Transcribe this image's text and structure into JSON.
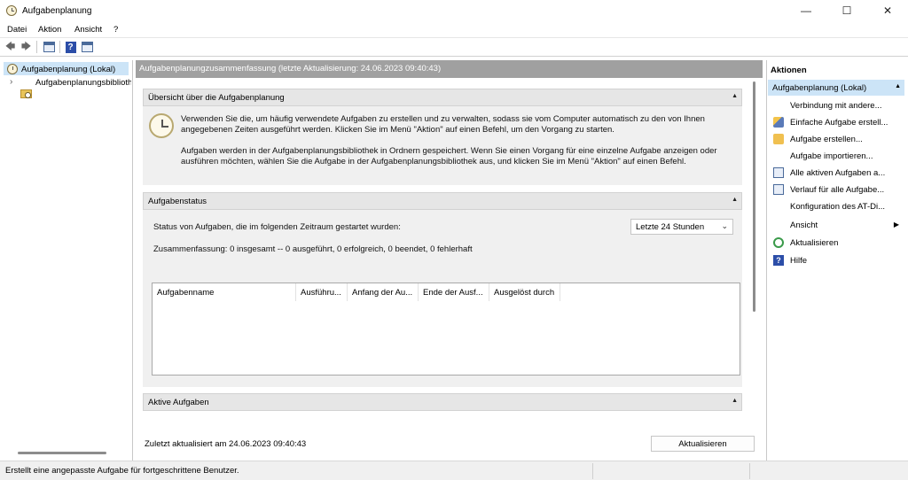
{
  "window": {
    "title": "Aufgabenplanung",
    "icon": "clock-icon",
    "controls": {
      "minimize": "—",
      "maximize": "☐",
      "close": "✕"
    }
  },
  "menu": {
    "items": [
      "Datei",
      "Aktion",
      "Ansicht",
      "?"
    ]
  },
  "toolbar": {
    "back": "🡄",
    "forward": "🡆",
    "help": "?"
  },
  "tree": {
    "root": "Aufgabenplanung (Lokal)",
    "child": "Aufgabenplanungsbibliothek",
    "expander": "›"
  },
  "center": {
    "header": "Aufgabenplanungzusammenfassung (letzte Aktualisierung: 24.06.2023 09:40:43)",
    "overview": {
      "title": "Übersicht über die Aufgabenplanung",
      "collapse": "▲",
      "para1": "Verwenden Sie die, um häufig verwendete Aufgaben zu erstellen und zu verwalten, sodass sie vom Computer automatisch zu den von Ihnen angegebenen Zeiten ausgeführt werden. Klicken Sie im Menü \"Aktion\" auf einen Befehl, um den Vorgang zu starten.",
      "para2": "Aufgaben werden in der Aufgabenplanungsbibliothek in Ordnern gespeichert. Wenn Sie einen Vorgang für eine einzelne Aufgabe anzeigen oder ausführen möchten, wählen Sie die Aufgabe in der Aufgabenplanungsbibliothek aus, und klicken Sie im Menü \"Aktion\" auf einen Befehl."
    },
    "status": {
      "title": "Aufgabenstatus",
      "collapse": "▲",
      "label": "Status von Aufgaben, die im folgenden Zeitraum gestartet wurden:",
      "period": "Letzte 24 Stunden",
      "period_chevron": "⌄",
      "summary": "Zusammenfassung: 0 insgesamt -- 0 ausgeführt, 0 erfolgreich, 0 beendet, 0 fehlerhaft",
      "columns": [
        "Aufgabenname",
        "Ausführu...",
        "Anfang der Au...",
        "Ende der Ausf...",
        "Ausgelöst durch"
      ]
    },
    "active": {
      "title": "Aktive Aufgaben",
      "collapse": "▲"
    },
    "last_updated": "Zuletzt aktualisiert am 24.06.2023 09:40:43",
    "refresh_button": "Aktualisieren"
  },
  "actions": {
    "title": "Aktionen",
    "group": "Aufgabenplanung (Lokal)",
    "group_arrow": "▲",
    "items": [
      {
        "label": "Verbindung mit andere...",
        "icon": "none"
      },
      {
        "label": "Einfache Aufgabe erstell...",
        "icon": "wizard-icon"
      },
      {
        "label": "Aufgabe erstellen...",
        "icon": "task-icon"
      },
      {
        "label": "Aufgabe importieren...",
        "icon": "none"
      },
      {
        "label": "Alle aktiven Aufgaben a...",
        "icon": "list-icon"
      },
      {
        "label": "Verlauf für alle Aufgabe...",
        "icon": "history-icon"
      },
      {
        "label": "Konfiguration des AT-Di...",
        "icon": "none"
      },
      {
        "label": "Ansicht",
        "icon": "none",
        "submenu": "▶"
      },
      {
        "label": "Aktualisieren",
        "icon": "refresh-icon"
      },
      {
        "label": "Hilfe",
        "icon": "help-icon",
        "glyph": "?"
      }
    ]
  },
  "statusbar": {
    "text": "Erstellt eine angepasste Aufgabe für fortgeschrittene Benutzer."
  }
}
